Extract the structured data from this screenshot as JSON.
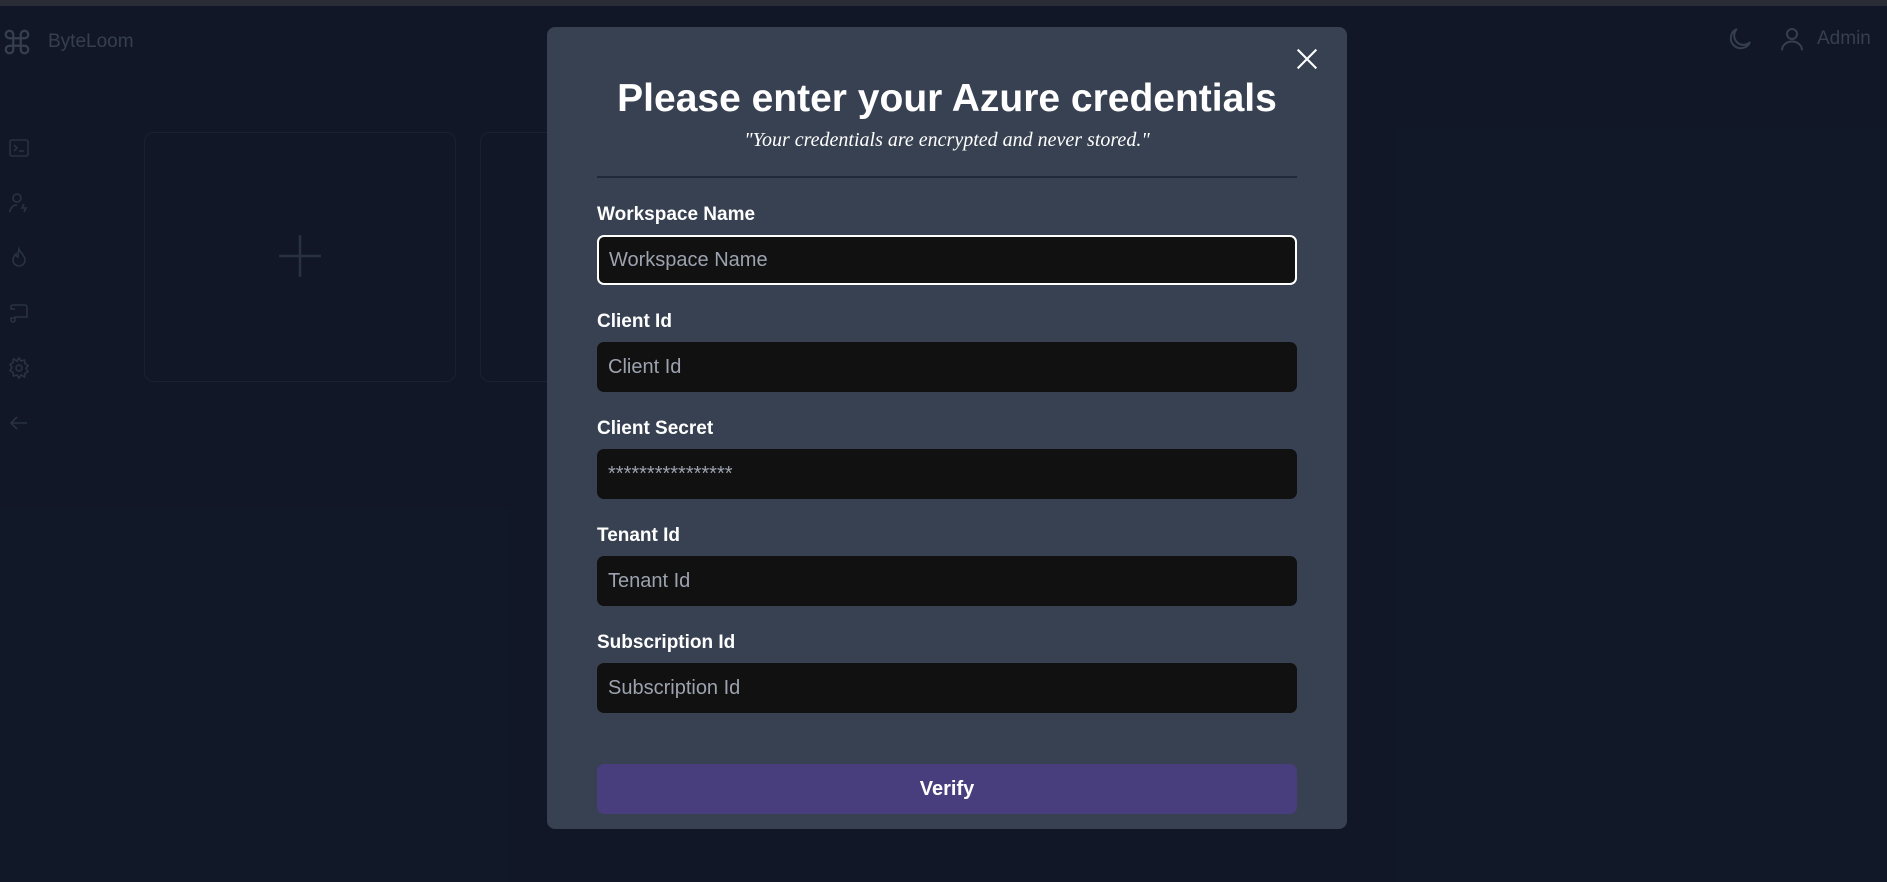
{
  "app": {
    "brand": "ByteLoom",
    "user_label": "Admin"
  },
  "sidebar": {
    "items": [
      {
        "icon": "terminal-icon"
      },
      {
        "icon": "user-bolt-icon"
      },
      {
        "icon": "flame-icon"
      },
      {
        "icon": "scroll-icon"
      },
      {
        "icon": "gear-icon"
      },
      {
        "icon": "arrow-left-icon"
      }
    ]
  },
  "modal": {
    "title": "Please enter your Azure credentials",
    "subtitle": "\"Your credentials are encrypted and never stored.\"",
    "fields": [
      {
        "label": "Workspace Name",
        "placeholder": "Workspace Name",
        "value": ""
      },
      {
        "label": "Client Id",
        "placeholder": "Client Id",
        "value": ""
      },
      {
        "label": "Client Secret",
        "placeholder": "****************",
        "value": ""
      },
      {
        "label": "Tenant Id",
        "placeholder": "Tenant Id",
        "value": ""
      },
      {
        "label": "Subscription Id",
        "placeholder": "Subscription Id",
        "value": ""
      }
    ],
    "submit_label": "Verify"
  },
  "colors": {
    "background": "#111827",
    "modal": "#374151",
    "input": "#111111",
    "button": "#483d7d"
  }
}
